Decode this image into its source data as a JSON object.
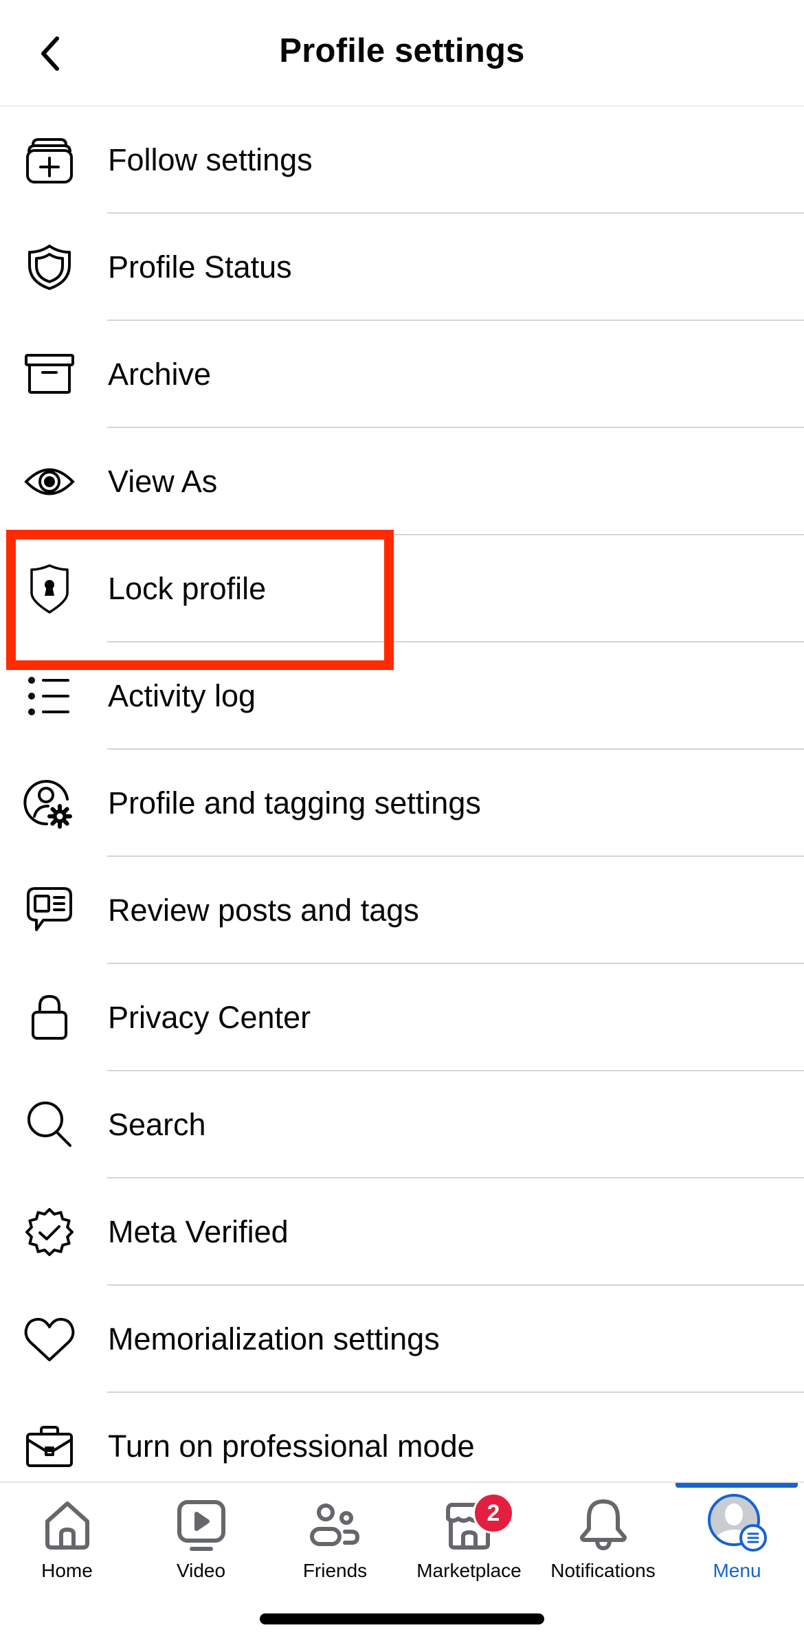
{
  "header": {
    "title": "Profile settings",
    "back_icon": "chevron-left-icon"
  },
  "menu_items": [
    {
      "label": "Follow settings",
      "icon": "follow-settings-icon"
    },
    {
      "label": "Profile Status",
      "icon": "shield-icon"
    },
    {
      "label": "Archive",
      "icon": "archive-box-icon"
    },
    {
      "label": "View As",
      "icon": "eye-icon"
    },
    {
      "label": "Lock profile",
      "icon": "shield-lock-icon",
      "highlighted": true
    },
    {
      "label": "Activity log",
      "icon": "list-icon"
    },
    {
      "label": "Profile and tagging settings",
      "icon": "user-gear-icon"
    },
    {
      "label": "Review posts and tags",
      "icon": "speech-bubble-news-icon"
    },
    {
      "label": "Privacy Center",
      "icon": "padlock-icon"
    },
    {
      "label": "Search",
      "icon": "search-icon"
    },
    {
      "label": "Meta Verified",
      "icon": "verified-badge-icon"
    },
    {
      "label": "Memorialization settings",
      "icon": "heart-icon"
    },
    {
      "label": "Turn on professional mode",
      "icon": "briefcase-icon"
    }
  ],
  "tabbar": {
    "tabs": [
      {
        "label": "Home",
        "icon": "home-icon"
      },
      {
        "label": "Video",
        "icon": "video-icon"
      },
      {
        "label": "Friends",
        "icon": "friends-icon"
      },
      {
        "label": "Marketplace",
        "icon": "marketplace-icon",
        "badge": "2"
      },
      {
        "label": "Notifications",
        "icon": "bell-icon"
      },
      {
        "label": "Menu",
        "icon": "avatar-menu-icon",
        "active": true
      }
    ]
  },
  "colors": {
    "highlight": "#ff2a00",
    "accent": "#1763cf",
    "badge": "#e41e3f",
    "tab_icon": "#65676b"
  }
}
